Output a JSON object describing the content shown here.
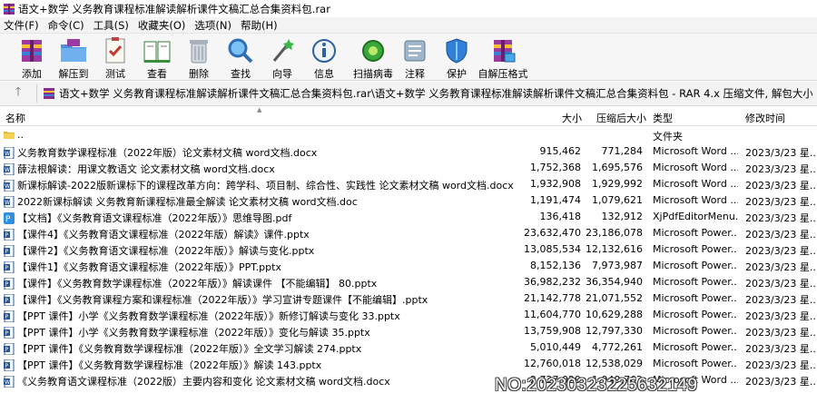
{
  "window": {
    "title": "语文+数学 义务教育课程标准解读解析课件文稿汇总合集资料包.rar"
  },
  "menu": [
    {
      "label": "文件(F)"
    },
    {
      "label": "命令(C)"
    },
    {
      "label": "工具(S)"
    },
    {
      "label": "收藏夹(O)"
    },
    {
      "label": "选项(N)"
    },
    {
      "label": "帮助(H)"
    }
  ],
  "toolbar": [
    {
      "label": "添加",
      "icon": "add-icon"
    },
    {
      "label": "解压到",
      "icon": "extract-to-icon"
    },
    {
      "label": "测试",
      "icon": "test-icon"
    },
    {
      "label": "查看",
      "icon": "view-icon"
    },
    {
      "label": "删除",
      "icon": "delete-icon"
    },
    {
      "label": "查找",
      "icon": "find-icon"
    },
    {
      "label": "向导",
      "icon": "wizard-icon"
    },
    {
      "label": "信息",
      "icon": "info-icon"
    },
    {
      "label": "扫描病毒",
      "icon": "virus-scan-icon"
    },
    {
      "label": "注释",
      "icon": "comment-icon"
    },
    {
      "label": "保护",
      "icon": "protect-icon"
    },
    {
      "label": "自解压格式",
      "icon": "sfx-icon"
    }
  ],
  "address": {
    "path": "语文+数学 义务教育课程标准解读解析课件文稿汇总合集资料包.rar\\语文+数学 义务教育课程标准解读解析课件文稿汇总合集资料包 - RAR 4.x 压缩文件, 解包大小为 154,785,954 字节"
  },
  "columns": {
    "name": "名称",
    "size": "大小",
    "packed": "压缩后大小",
    "type": "类型",
    "modified": "修改时间"
  },
  "files": [
    {
      "name": "..",
      "size": "",
      "packed": "",
      "type": "文件夹",
      "modified": "",
      "icon": "folder-icon"
    },
    {
      "name": "义务教育数学课程标准（2022年版）论文素材文稿 word文档.docx",
      "size": "915,462",
      "packed": "771,284",
      "type": "Microsoft Word ...",
      "modified": "2023/3/23 星...",
      "icon": "word-doc-icon"
    },
    {
      "name": "薛法根解读：用课文教语文 论文素材文稿 word文档.docx",
      "size": "1,752,368",
      "packed": "1,695,576",
      "type": "Microsoft Word ...",
      "modified": "2023/3/23 星...",
      "icon": "word-doc-icon"
    },
    {
      "name": "新课标解读-2022版新课标下的课程改革方向：跨学科、项目制、综合性、实践性  论文素材文稿 word文档.docx",
      "size": "1,932,908",
      "packed": "1,929,992",
      "type": "Microsoft Word ...",
      "modified": "2023/3/23 星...",
      "icon": "word-doc-icon"
    },
    {
      "name": "2022新课标解读  义务教育新课程标准最全解读 论文素材文稿 word文档.doc",
      "size": "1,191,474",
      "packed": "1,079,621",
      "type": "Microsoft Word ...",
      "modified": "2023/3/23 星...",
      "icon": "word-doc-icon"
    },
    {
      "name": "【文档】《义务教育语文课程标准（2022年版）》思维导图.pdf",
      "size": "136,418",
      "packed": "132,912",
      "type": "XjPdfEditorMenu...",
      "modified": "2023/3/23 星...",
      "icon": "pdf-icon"
    },
    {
      "name": "【课件4】《义务教育语文课程标准（2022年版）解读》课件.pptx",
      "size": "23,632,470",
      "packed": "23,186,078",
      "type": "Microsoft Power...",
      "modified": "2023/3/23 星...",
      "icon": "ppt-icon"
    },
    {
      "name": "【课件2】《义务教育语文课程标准（2022年版）》解读与变化.pptx",
      "size": "13,085,534",
      "packed": "12,132,616",
      "type": "Microsoft Power...",
      "modified": "2023/3/23 星...",
      "icon": "ppt-icon"
    },
    {
      "name": "【课件1】《义务教育语文课程标准（2022年版）》PPT.pptx",
      "size": "8,152,136",
      "packed": "7,973,987",
      "type": "Microsoft Power...",
      "modified": "2023/3/23 星...",
      "icon": "ppt-icon"
    },
    {
      "name": "【课件】《义务教育数学课程标准（2022年版）》解读课件 【不能编辑】 80.pptx",
      "size": "36,982,232",
      "packed": "36,354,940",
      "type": "Microsoft Power...",
      "modified": "2023/3/23 星...",
      "icon": "ppt-icon"
    },
    {
      "name": "【课件】《义务教育课程方案和课程标准（2022年版）》学习宣讲专题课件【不能编辑】.pptx",
      "size": "21,142,778",
      "packed": "21,071,552",
      "type": "Microsoft Power...",
      "modified": "2023/3/23 星...",
      "icon": "ppt-icon"
    },
    {
      "name": "【PPT 课件】小学《义务教育数学课程标准（2022年版）》新修订解读与变化 33.pptx",
      "size": "11,604,770",
      "packed": "10,629,288",
      "type": "Microsoft Power...",
      "modified": "2023/3/23 星...",
      "icon": "ppt-icon"
    },
    {
      "name": "【PPT 课件】小学《义务教育数学课程标准（2022年版）》变化与解读 35.pptx",
      "size": "13,759,908",
      "packed": "12,797,330",
      "type": "Microsoft Power...",
      "modified": "2023/3/23 星...",
      "icon": "ppt-icon"
    },
    {
      "name": "【PPT 课件】《义务教育数学课程标准（2022年版）》全文学习解读 274.pptx",
      "size": "5,010,449",
      "packed": "4,772,261",
      "type": "Microsoft Power...",
      "modified": "2023/3/23 星...",
      "icon": "ppt-icon"
    },
    {
      "name": "【PPT 课件】《义务教育数学课程标准（2022年版）》解读 143.pptx",
      "size": "12,760,018",
      "packed": "12,538,029",
      "type": "Microsoft Power...",
      "modified": "2023/3/23 星...",
      "icon": "ppt-icon"
    },
    {
      "name": "《义务教育语文课程标准（2022版）主要内容和变化  论文素材文稿 word文档.docx",
      "size": "2,727,029",
      "packed": "1,949,762",
      "type": "Microsoft Word ...",
      "modified": "2023/3/23 星...",
      "icon": "word-doc-icon"
    }
  ],
  "watermark": "NO:20230323225632149"
}
